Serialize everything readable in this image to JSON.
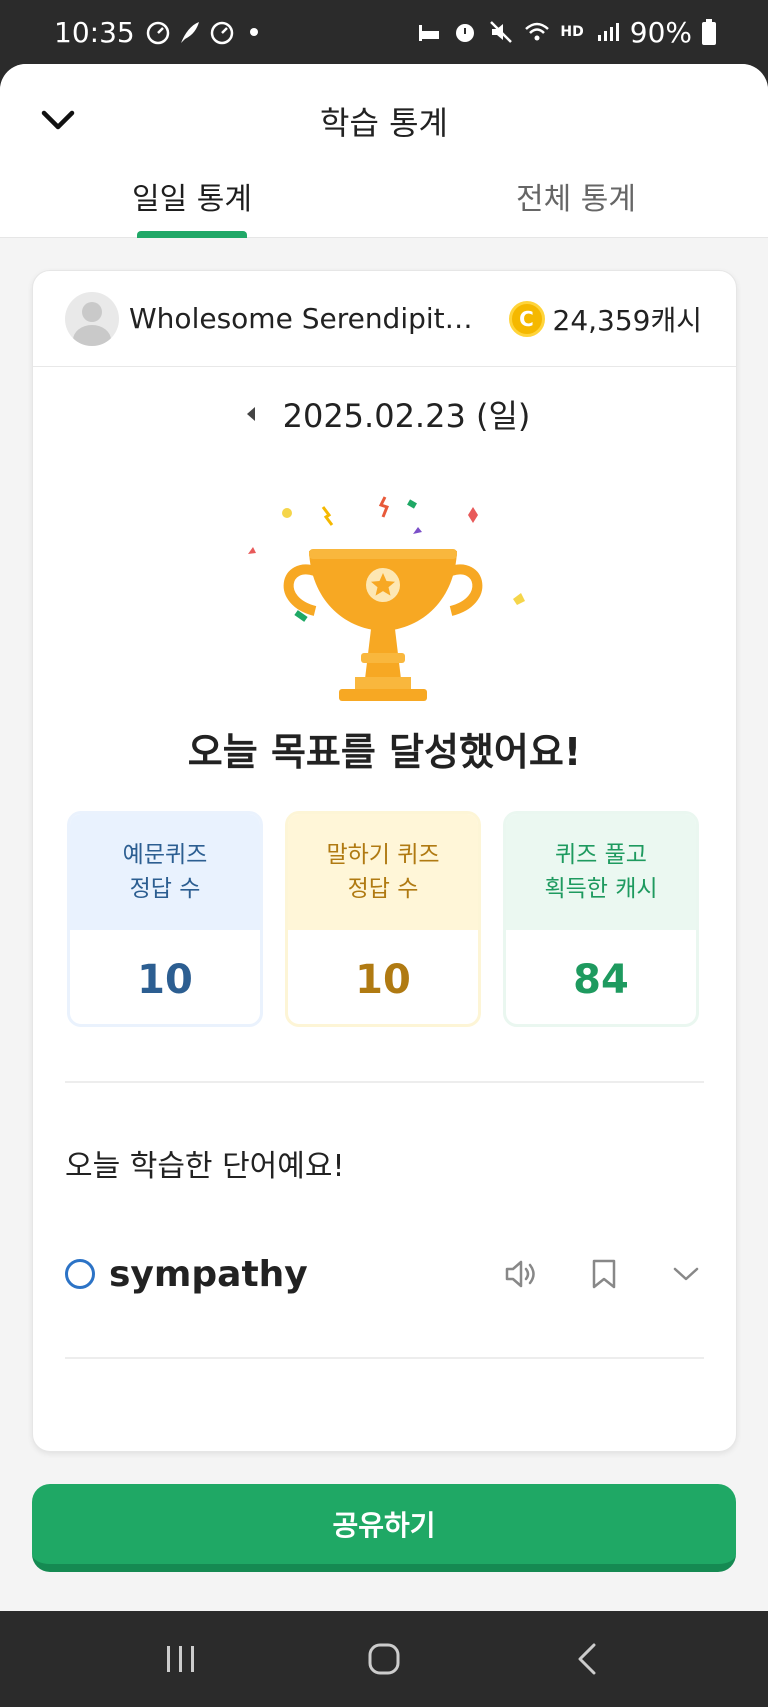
{
  "status_bar": {
    "time": "10:35",
    "hd_label": "HD",
    "battery": "90%"
  },
  "header": {
    "title": "학습 통계",
    "tabs": [
      {
        "label": "일일 통계",
        "active": true
      },
      {
        "label": "전체 통계",
        "active": false
      }
    ]
  },
  "profile": {
    "username": "Wholesome Serendipitou...",
    "coin_symbol": "C",
    "cash": "24,359캐시"
  },
  "date": "2025.02.23 (일)",
  "goal_message": "오늘 목표를 달성했어요!",
  "stats": [
    {
      "line1": "예문퀴즈",
      "line2": "정답 수",
      "value": "10",
      "color": "#2c5e91"
    },
    {
      "line1": "말하기 퀴즈",
      "line2": "정답 수",
      "value": "10",
      "color": "#b07a12"
    },
    {
      "line1": "퀴즈 풀고",
      "line2": "획득한 캐시",
      "value": "84",
      "color": "#1e9a5f"
    }
  ],
  "learned_heading": "오늘 학습한 단어예요!",
  "words": [
    {
      "word": "sympathy"
    }
  ],
  "share_button": "공유하기",
  "colors": {
    "accent": "#1fa865",
    "trophy": "#f7a823"
  }
}
